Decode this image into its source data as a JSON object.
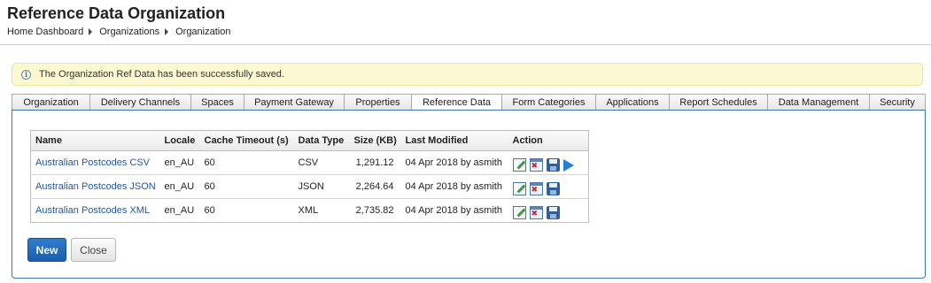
{
  "header": {
    "title": "Reference Data Organization",
    "breadcrumb": [
      "Home Dashboard",
      "Organizations",
      "Organization"
    ]
  },
  "alert": {
    "icon": "info-icon",
    "message": "The Organization Ref Data has been successfully saved."
  },
  "tabs": [
    {
      "label": "Organization",
      "active": false
    },
    {
      "label": "Delivery Channels",
      "active": false
    },
    {
      "label": "Spaces",
      "active": false
    },
    {
      "label": "Payment Gateway",
      "active": false
    },
    {
      "label": "Properties",
      "active": false
    },
    {
      "label": "Reference Data",
      "active": true
    },
    {
      "label": "Form Categories",
      "active": false
    },
    {
      "label": "Applications",
      "active": false
    },
    {
      "label": "Report Schedules",
      "active": false
    },
    {
      "label": "Data Management",
      "active": false
    },
    {
      "label": "Security",
      "active": false
    }
  ],
  "table": {
    "columns": [
      "Name",
      "Locale",
      "Cache Timeout (s)",
      "Data Type",
      "Size (KB)",
      "Last Modified",
      "Action"
    ],
    "rows": [
      {
        "name": "Australian Postcodes CSV",
        "locale": "en_AU",
        "cache_timeout": "60",
        "data_type": "CSV",
        "size": "1,291.12",
        "last_modified": "04 Apr 2018 by asmith",
        "actions": [
          "edit-icon",
          "delete-icon",
          "save-icon",
          "run-icon"
        ]
      },
      {
        "name": "Australian Postcodes JSON",
        "locale": "en_AU",
        "cache_timeout": "60",
        "data_type": "JSON",
        "size": "2,264.64",
        "last_modified": "04 Apr 2018 by asmith",
        "actions": [
          "edit-icon",
          "delete-icon",
          "save-icon"
        ]
      },
      {
        "name": "Australian Postcodes XML",
        "locale": "en_AU",
        "cache_timeout": "60",
        "data_type": "XML",
        "size": "2,735.82",
        "last_modified": "04 Apr 2018 by asmith",
        "actions": [
          "edit-icon",
          "delete-icon",
          "save-icon"
        ]
      }
    ]
  },
  "buttons": {
    "new_label": "New",
    "close_label": "Close"
  },
  "colors": {
    "primary": "#1a5fac",
    "link": "#2156a5",
    "alert_bg": "#fcf8d2",
    "panel_border": "#3b74ae"
  }
}
